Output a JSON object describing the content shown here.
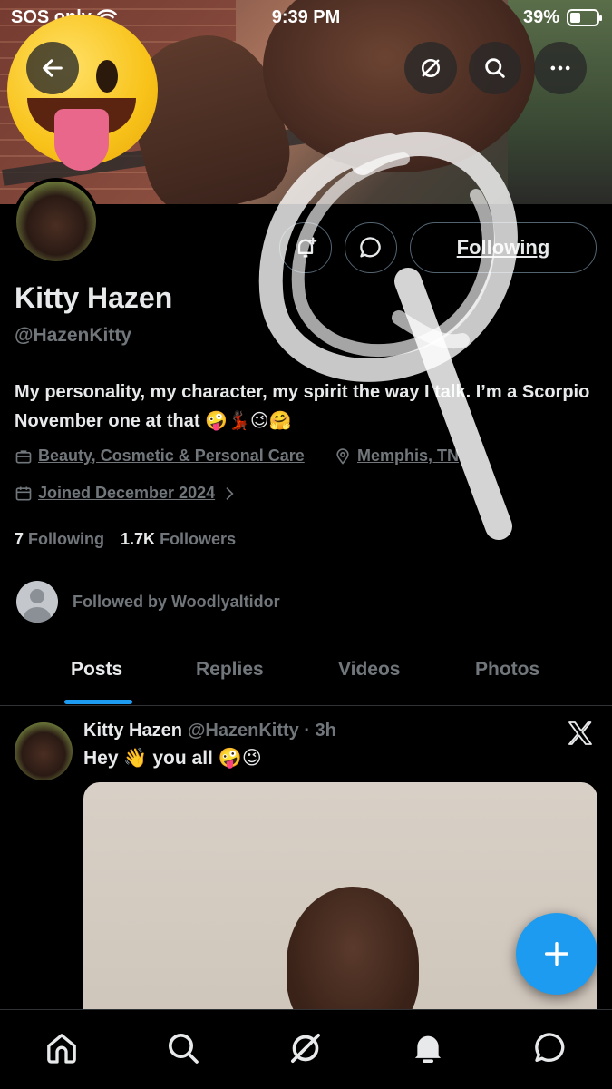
{
  "status_bar": {
    "carrier": "SOS only",
    "time": "9:39 PM",
    "battery": "39%"
  },
  "header": {
    "back_icon": "arrow-left-icon",
    "grok_icon": "slash-circle-icon",
    "search_icon": "search-icon",
    "more_icon": "more-horizontal-icon"
  },
  "profile": {
    "name": "Kitty Hazen",
    "handle": "@HazenKitty",
    "bio": "My personality, my character, my spirit the way I talk. I’m a Scorpio November one at that 🤪💃🏿😉🤗",
    "category": "Beauty, Cosmetic & Personal Care",
    "location": "Memphis, TN",
    "joined": "Joined December 2024",
    "following_count": "7",
    "following_label": "Following",
    "followers_count": "1.7K",
    "followers_label": "Followers",
    "followed_by": "Followed by Woodlyaltidor",
    "follow_button": "Following"
  },
  "tabs": [
    {
      "label": "Posts",
      "active": true
    },
    {
      "label": "Replies",
      "active": false
    },
    {
      "label": "Videos",
      "active": false
    },
    {
      "label": "Photos",
      "active": false
    }
  ],
  "post": {
    "name": "Kitty Hazen",
    "handle_time": "@HazenKitty · 3h",
    "text": "Hey 👋 you all 🤪😉"
  },
  "bottom_nav": [
    "home-icon",
    "search-icon",
    "grok-icon",
    "notifications-icon",
    "messages-icon"
  ],
  "colors": {
    "accent": "#1d9bf0",
    "background": "#000000",
    "secondary_text": "#71767b"
  }
}
